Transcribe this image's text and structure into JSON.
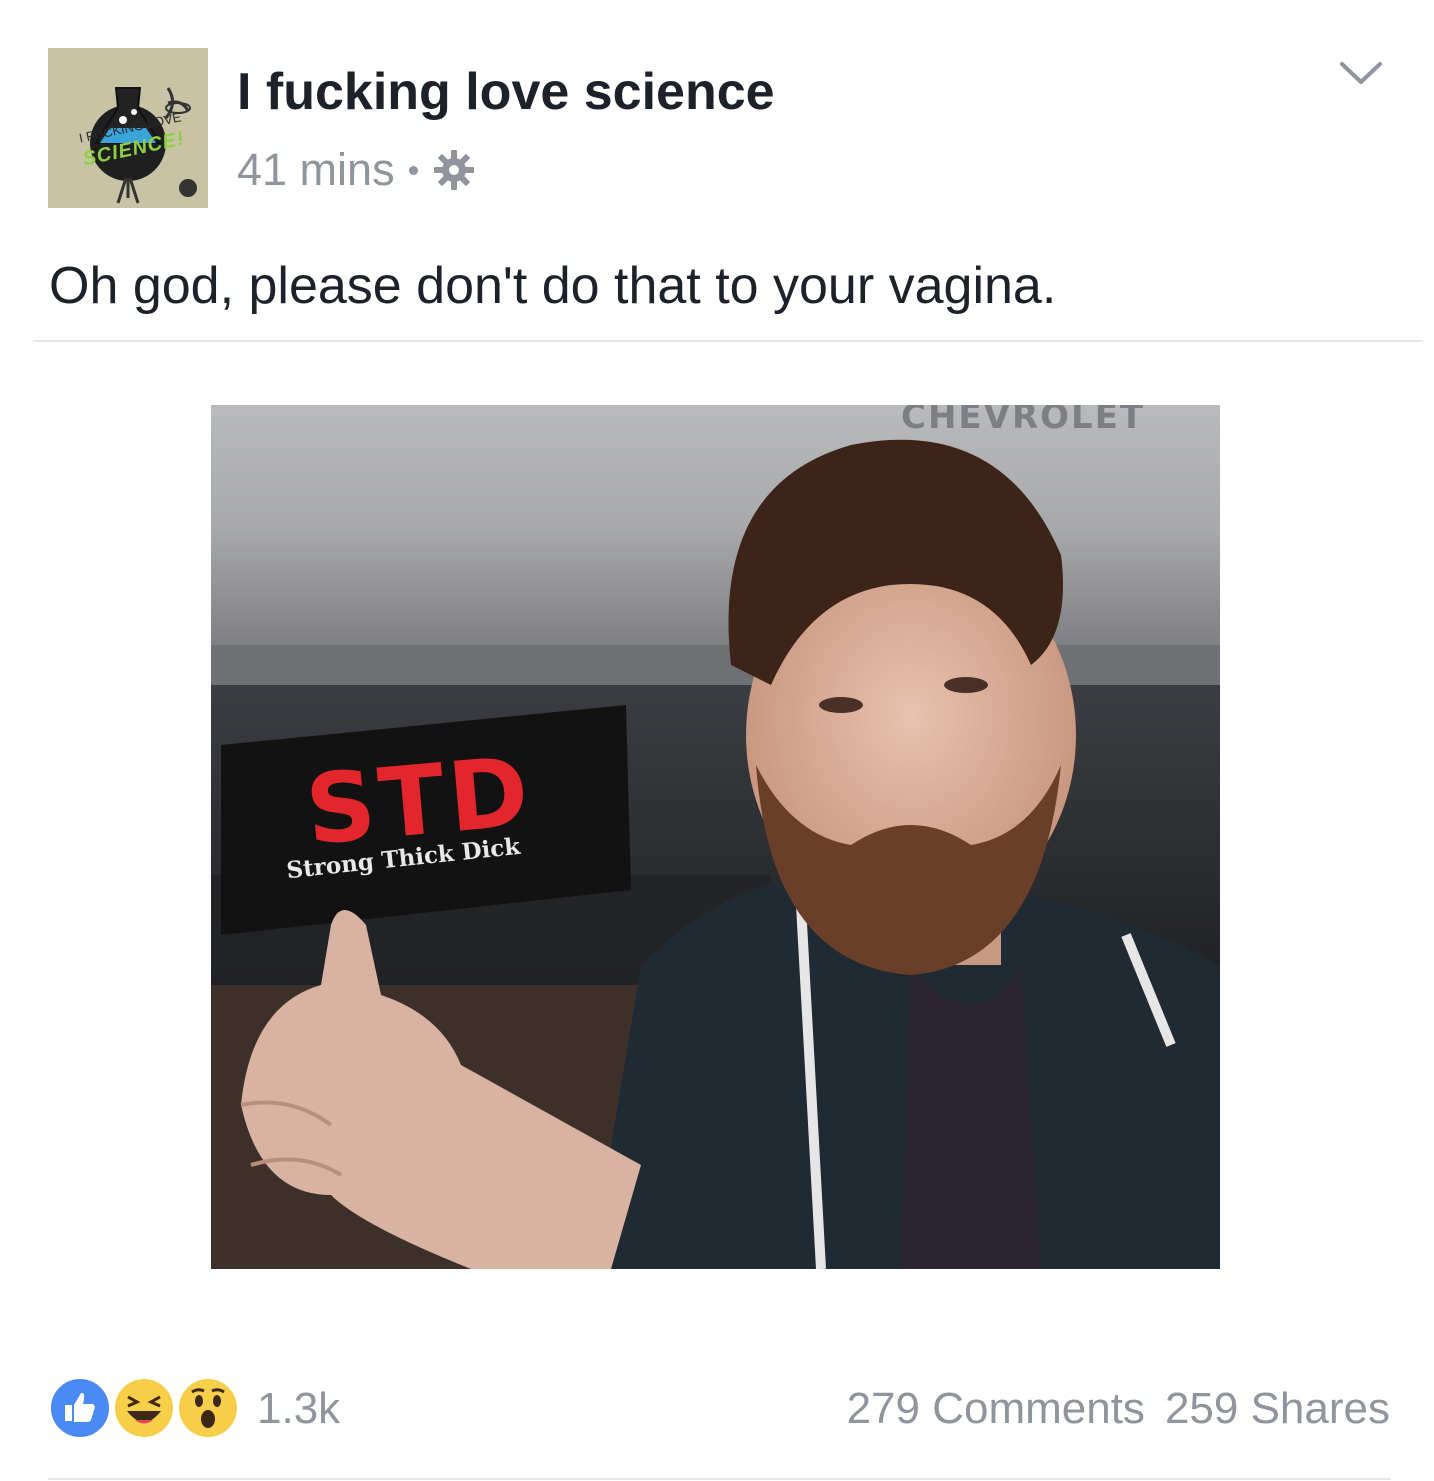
{
  "post": {
    "page_name": "I fucking love science",
    "timestamp": "41 mins",
    "separator": "•",
    "caption": "Oh god, please don't do that to your vagina.",
    "avatar_logo_line1": "I FUCKING LOVE",
    "avatar_logo_line2": "SCIENCE!"
  },
  "photo": {
    "plate_title": "STD",
    "plate_subtitle": "Strong Thick Dick",
    "truck_brand": "CHEVROLET"
  },
  "footer": {
    "reactions": [
      "like-icon",
      "haha-icon",
      "wow-icon"
    ],
    "reaction_count": "1.3k",
    "comments": "279 Comments",
    "shares": "259 Shares"
  },
  "colors": {
    "text_primary": "#1d2129",
    "text_secondary": "#90949c",
    "like_blue": "#4a8af4",
    "emoji_yellow": "#f7cf4a",
    "plate_red": "#e2262c"
  }
}
